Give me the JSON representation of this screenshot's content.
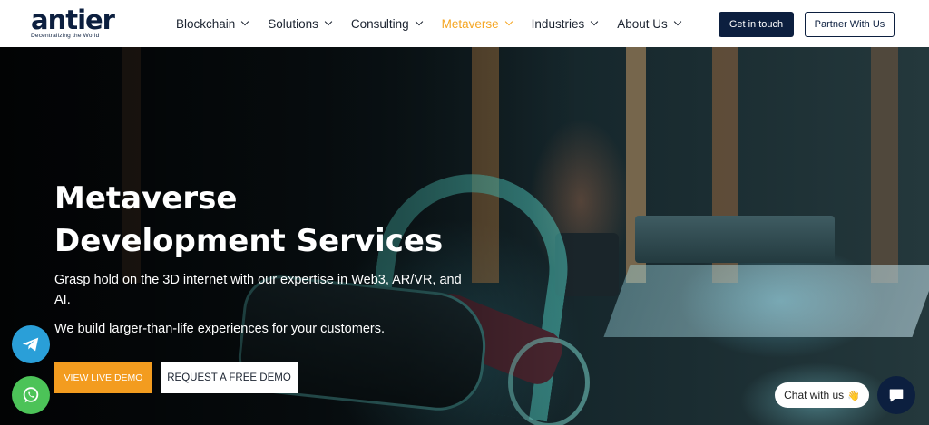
{
  "brand": {
    "name": "antier",
    "tagline": "Decentralizing the World",
    "accent_color": "#f39c1f",
    "primary_color": "#0c1f3f"
  },
  "nav": {
    "items": [
      {
        "label": "Blockchain",
        "active": false
      },
      {
        "label": "Solutions",
        "active": false
      },
      {
        "label": "Consulting",
        "active": false
      },
      {
        "label": "Metaverse",
        "active": true
      },
      {
        "label": "Industries",
        "active": false
      },
      {
        "label": "About Us",
        "active": false
      }
    ],
    "cta_primary": "Get in touch",
    "cta_secondary": "Partner With Us"
  },
  "hero": {
    "title": "Metaverse Development Services",
    "description_1": "Grasp hold on the 3D internet with our expertise in Web3, AR/VR, and AI.",
    "description_2": "We build larger-than-life experiences for your customers.",
    "button_demo": "VIEW LIVE DEMO",
    "button_request": "REQUEST A FREE DEMO"
  },
  "floating": {
    "telegram_icon": "telegram-icon",
    "whatsapp_icon": "whatsapp-icon",
    "chat_label": "Chat with us",
    "chat_emoji": "👋",
    "chat_icon": "chat-bubble-icon"
  }
}
